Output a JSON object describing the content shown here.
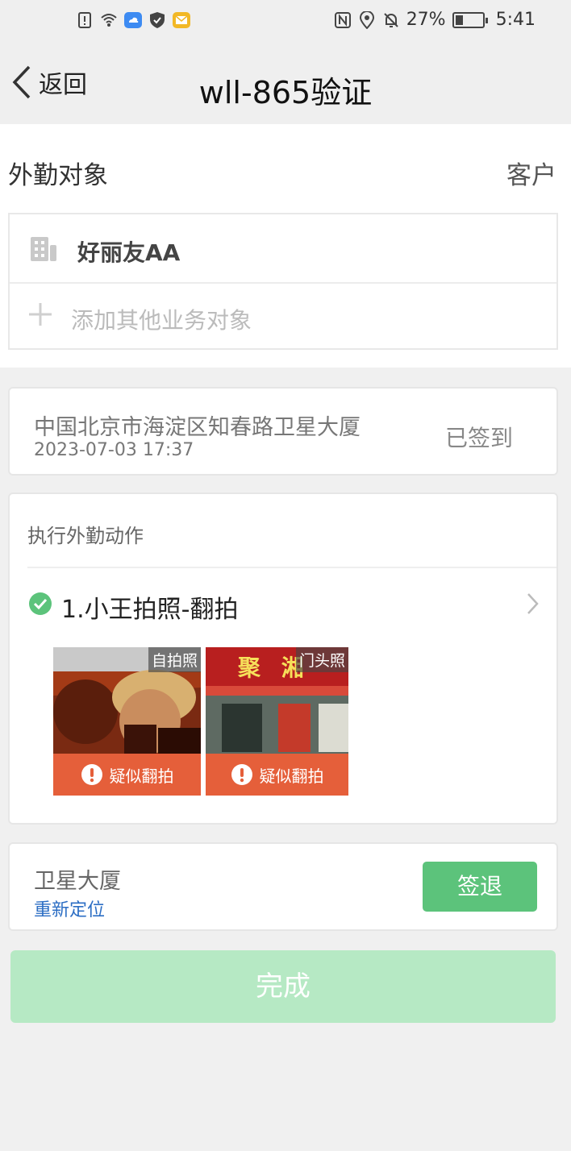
{
  "status_bar": {
    "battery_percent_text": "27%",
    "battery_level": 0.27,
    "time": "5:41",
    "left_icons": [
      "sim-alert-icon",
      "wifi-icon",
      "cloud-icon",
      "shield-icon",
      "mail-icon"
    ],
    "right_icons": [
      "nfc-icon",
      "location-icon",
      "bell-muted-icon",
      "battery-icon"
    ]
  },
  "nav": {
    "back_label": "返回",
    "title": "wll-865验证"
  },
  "object_section": {
    "label": "外勤对象",
    "type": "客户",
    "customer_name": "好丽友AA",
    "add_placeholder": "添加其他业务对象"
  },
  "location": {
    "address": "中国北京市海淀区知春路卫星大厦",
    "timestamp": "2023-07-03 17:37",
    "status": "已签到"
  },
  "actions": {
    "header": "执行外勤动作",
    "item_title": "1.小王拍照-翻拍",
    "photos": [
      {
        "tag": "自拍照",
        "warning": "疑似翻拍"
      },
      {
        "tag": "门头照",
        "warning": "疑似翻拍"
      }
    ],
    "storefront_sign_text": "聚 湘"
  },
  "sign_out": {
    "place": "卫星大厦",
    "relocate_label": "重新定位",
    "button_label": "签退"
  },
  "complete_button": "完成",
  "colors": {
    "accent_green": "#5cc37b",
    "done_disabled_green": "#b6e9c4",
    "warning_orange": "#e55f3a",
    "link_blue": "#2c6ec4"
  }
}
